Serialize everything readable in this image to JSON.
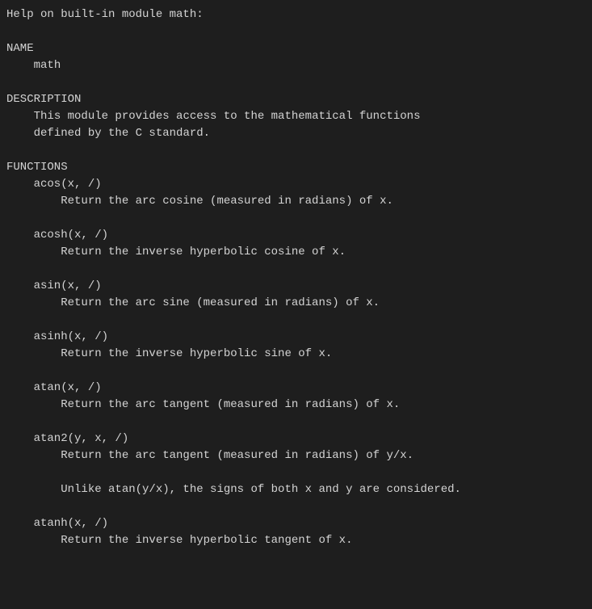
{
  "header": "Help on built-in module math:",
  "name_section": {
    "heading": "NAME",
    "value": "math"
  },
  "description_section": {
    "heading": "DESCRIPTION",
    "lines": [
      "This module provides access to the mathematical functions",
      "defined by the C standard."
    ]
  },
  "functions_section": {
    "heading": "FUNCTIONS",
    "functions": [
      {
        "signature": "acos(x, /)",
        "lines": [
          "Return the arc cosine (measured in radians) of x."
        ]
      },
      {
        "signature": "acosh(x, /)",
        "lines": [
          "Return the inverse hyperbolic cosine of x."
        ]
      },
      {
        "signature": "asin(x, /)",
        "lines": [
          "Return the arc sine (measured in radians) of x."
        ]
      },
      {
        "signature": "asinh(x, /)",
        "lines": [
          "Return the inverse hyperbolic sine of x."
        ]
      },
      {
        "signature": "atan(x, /)",
        "lines": [
          "Return the arc tangent (measured in radians) of x."
        ]
      },
      {
        "signature": "atan2(y, x, /)",
        "lines": [
          "Return the arc tangent (measured in radians) of y/x.",
          "",
          "Unlike atan(y/x), the signs of both x and y are considered."
        ]
      },
      {
        "signature": "atanh(x, /)",
        "lines": [
          "Return the inverse hyperbolic tangent of x."
        ]
      }
    ]
  }
}
